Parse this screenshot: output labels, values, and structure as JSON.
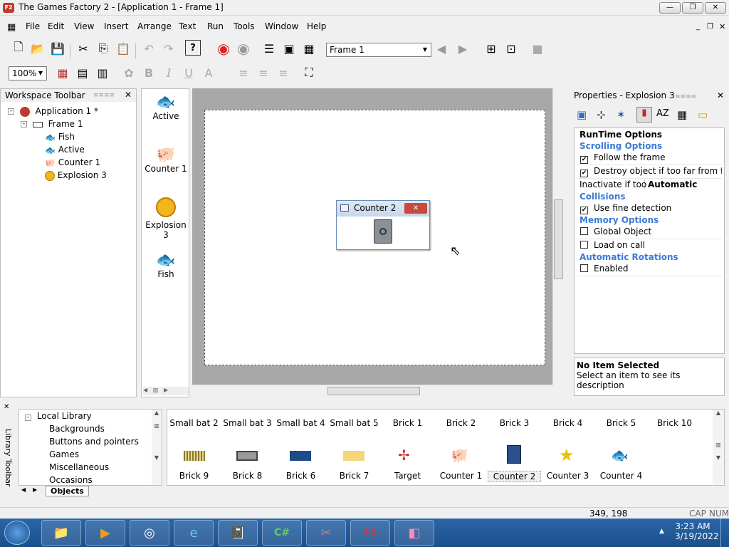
{
  "window": {
    "title": "The Games Factory 2 - [Application 1 - Frame 1]",
    "app_icon_text": "F2"
  },
  "menu": [
    "File",
    "Edit",
    "View",
    "Insert",
    "Arrange",
    "Text",
    "Run",
    "Tools",
    "Window",
    "Help"
  ],
  "toolbar": {
    "frame_select": "Frame 1",
    "zoom": "100%"
  },
  "workspace": {
    "title": "Workspace Toolbar",
    "tree": [
      {
        "label": "Application 1 *",
        "icon": "application-icon"
      },
      {
        "label": "Frame 1",
        "icon": "frame-icon"
      },
      {
        "label": "Fish",
        "icon": "fish-icon"
      },
      {
        "label": "Active",
        "icon": "fish-icon"
      },
      {
        "label": "Counter 1",
        "icon": "pig-icon"
      },
      {
        "label": "Explosion 3",
        "icon": "explosion-icon"
      }
    ]
  },
  "objects": [
    "Active",
    "Counter 1",
    "Explosion 3",
    "Fish"
  ],
  "canvas": {
    "counter_window_title": "Counter 2"
  },
  "properties": {
    "title": "Properties - Explosion 3",
    "header": "RunTime Options",
    "rows": [
      {
        "type": "section",
        "label": "Scrolling Options"
      },
      {
        "type": "check",
        "label": "Follow the frame",
        "checked": true
      },
      {
        "type": "check",
        "label": "Destroy object if too far from fra",
        "checked": true
      },
      {
        "type": "value",
        "label": "Inactivate if too",
        "value": "Automatic"
      },
      {
        "type": "section",
        "label": "Collisions"
      },
      {
        "type": "check",
        "label": "Use fine detection",
        "checked": true
      },
      {
        "type": "section",
        "label": "Memory Options"
      },
      {
        "type": "check",
        "label": "Global Object",
        "checked": false
      },
      {
        "type": "check",
        "label": "Load on call",
        "checked": false
      },
      {
        "type": "section",
        "label": "Automatic Rotations"
      },
      {
        "type": "check",
        "label": "Enabled",
        "checked": false
      }
    ],
    "desc_title": "No Item Selected",
    "desc_text": "Select an item to see its description"
  },
  "library": {
    "side_label": "Library Toolbar",
    "tree_root": "Local Library",
    "tree_items": [
      "Backgrounds",
      "Buttons and pointers",
      "Games",
      "Miscellaneous",
      "Occasions"
    ],
    "tab": "Objects",
    "row1": [
      "Small bat 2",
      "Small bat 3",
      "Small bat 4",
      "Small bat 5",
      "Brick 1",
      "Brick 2",
      "Brick 3",
      "Brick 4",
      "Brick 5",
      "Brick 10"
    ],
    "row2": [
      "Brick 9",
      "Brick 8",
      "Brick 6",
      "Brick 7",
      "Target",
      "Counter 1",
      "Counter 2",
      "Counter 3",
      "Counter 4"
    ]
  },
  "status": {
    "coords": "349, 198",
    "cap": "CAP",
    "num": "NUM"
  },
  "taskbar": {
    "time": "3:23 AM",
    "date": "3/19/2022"
  }
}
